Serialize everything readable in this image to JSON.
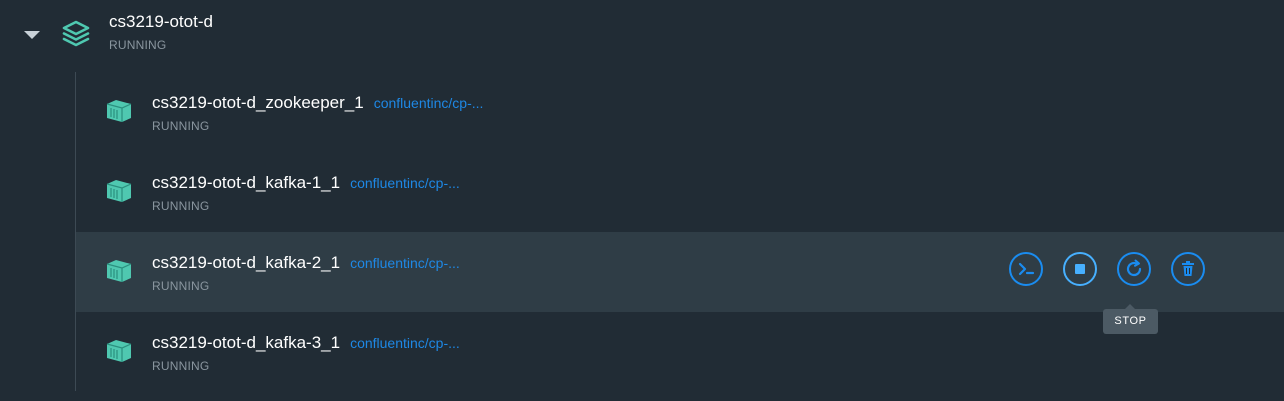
{
  "group": {
    "name": "cs3219-otot-d",
    "status": "RUNNING",
    "expand_icon": "caret-down-icon",
    "icon": "stack-layers-icon"
  },
  "containers": [
    {
      "name": "cs3219-otot-d_zookeeper_1",
      "image": "confluentinc/cp-...",
      "status": "RUNNING"
    },
    {
      "name": "cs3219-otot-d_kafka-1_1",
      "image": "confluentinc/cp-...",
      "status": "RUNNING"
    },
    {
      "name": "cs3219-otot-d_kafka-2_1",
      "image": "confluentinc/cp-...",
      "status": "RUNNING"
    },
    {
      "name": "cs3219-otot-d_kafka-3_1",
      "image": "confluentinc/cp-...",
      "status": "RUNNING"
    }
  ],
  "row_actions": [
    {
      "name": "cli",
      "icon": "terminal-icon"
    },
    {
      "name": "stop",
      "icon": "stop-icon"
    },
    {
      "name": "restart",
      "icon": "restart-icon"
    },
    {
      "name": "delete",
      "icon": "trash-icon"
    }
  ],
  "tooltip": {
    "text": "STOP"
  },
  "colors": {
    "background": "#212c35",
    "row_hover": "#2f3d46",
    "accent_blue": "#1a8cf0",
    "link_blue": "#1e88e5",
    "container_icon": "#4fc8b0",
    "status_text": "#8a969f"
  }
}
